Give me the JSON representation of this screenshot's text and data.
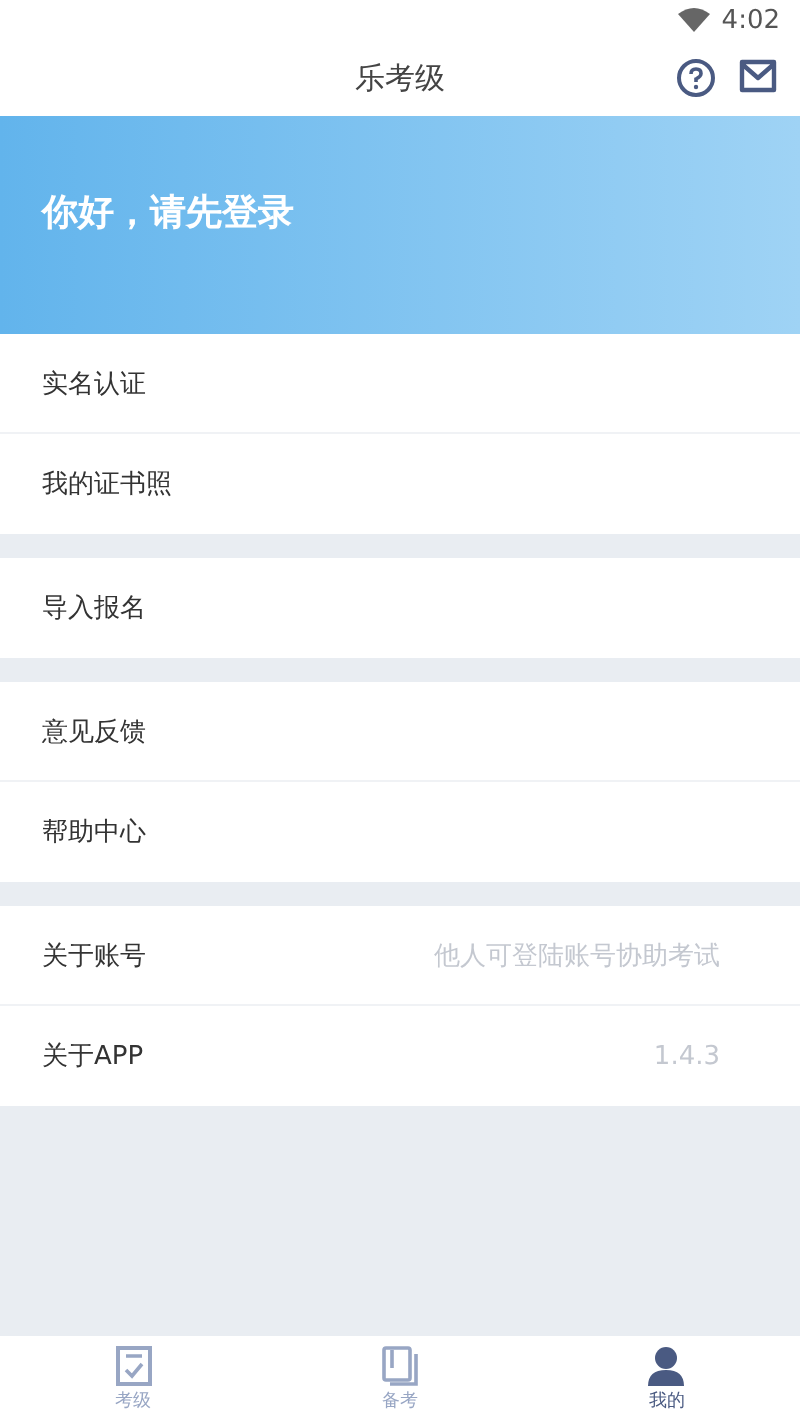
{
  "status_bar": {
    "time": "4:02"
  },
  "header": {
    "title": "乐考级"
  },
  "banner": {
    "greeting": "你好，请先登录"
  },
  "menu_groups": [
    {
      "items": [
        {
          "label": "实名认证"
        },
        {
          "label": "我的证书照"
        }
      ]
    },
    {
      "items": [
        {
          "label": "导入报名"
        }
      ]
    },
    {
      "items": [
        {
          "label": "意见反馈"
        },
        {
          "label": "帮助中心"
        }
      ]
    },
    {
      "items": [
        {
          "label": "关于账号",
          "value": "他人可登陆账号协助考试"
        },
        {
          "label": "关于APP",
          "value": "1.4.3"
        }
      ]
    }
  ],
  "tab_bar": [
    {
      "kind": "exam",
      "label": "考级",
      "selected": false
    },
    {
      "kind": "book",
      "label": "备考",
      "selected": false
    },
    {
      "kind": "profile",
      "label": "我的",
      "selected": true
    }
  ]
}
